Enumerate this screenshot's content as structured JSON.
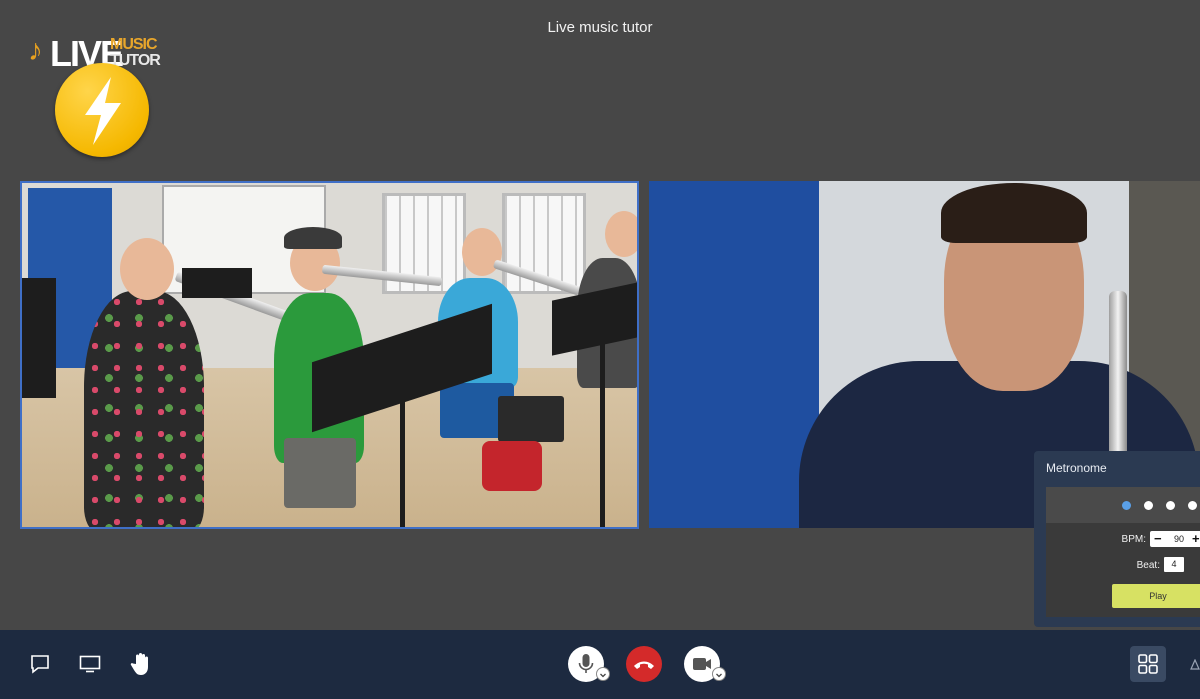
{
  "window": {
    "title": "Live music tutor"
  },
  "logo": {
    "word_live": "LIVE",
    "word_music": "MUSIC",
    "word_tutor": "TUTOR"
  },
  "videos": {
    "left": {
      "label": "Student classroom video feed"
    },
    "right": {
      "label": "Tutor video feed"
    }
  },
  "metronome": {
    "title": "Metronome",
    "beat_dots": 4,
    "active_dot": 1,
    "bpm_label": "BPM:",
    "bpm_value": "90",
    "beat_label": "Beat:",
    "beat_value": "4",
    "play_label": "Play",
    "accent_color": "#5aa0e8",
    "play_color": "#d7e163"
  },
  "toolbar": {
    "chat_icon": "chat-bubble-icon",
    "screen_icon": "screen-share-icon",
    "hand_icon": "raise-hand-icon",
    "mic_icon": "microphone-icon",
    "hangup_icon": "hang-up-icon",
    "camera_icon": "video-camera-icon",
    "grid_icon": "tile-view-icon",
    "hangup_color": "#d42a2a"
  }
}
